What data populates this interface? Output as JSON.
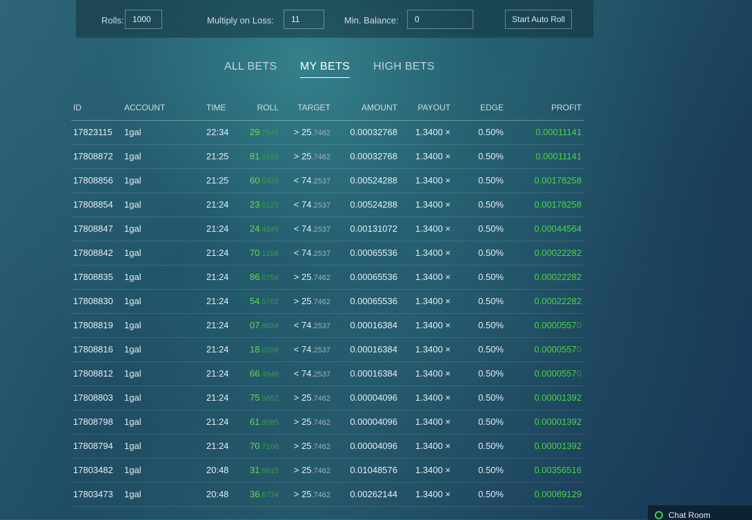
{
  "autoroll": {
    "rolls_label": "Rolls:",
    "rolls_value": "1000",
    "multiply_label": "Multiply on Loss:",
    "multiply_value": "11",
    "min_balance_label": "Min. Balance:",
    "min_balance_value": "0",
    "start_button": "Start Auto Roll"
  },
  "tabs": [
    {
      "label": "ALL BETS",
      "active": false
    },
    {
      "label": "MY BETS",
      "active": true
    },
    {
      "label": "HIGH BETS",
      "active": false
    }
  ],
  "table": {
    "headers": [
      "ID",
      "ACCOUNT",
      "TIME",
      "ROLL",
      "TARGET",
      "AMOUNT",
      "PAYOUT",
      "EDGE",
      "PROFIT"
    ],
    "rows": [
      {
        "id": "17823115",
        "account": "1gal",
        "time": "22:34",
        "roll_int": "29",
        "roll_frac": ".7545",
        "target_op": "> 25",
        "target_frac": ".7462",
        "amount": "0.00032768",
        "payout": "1.3400 ×",
        "edge": "0.50%",
        "profit": "0.00011141",
        "profit_tail": ""
      },
      {
        "id": "17808872",
        "account": "1gal",
        "time": "21:25",
        "roll_int": "81",
        "roll_frac": ".0193",
        "target_op": "> 25",
        "target_frac": ".7462",
        "amount": "0.00032768",
        "payout": "1.3400 ×",
        "edge": "0.50%",
        "profit": "0.00011141",
        "profit_tail": ""
      },
      {
        "id": "17808856",
        "account": "1gal",
        "time": "21:25",
        "roll_int": "60",
        "roll_frac": ".5434",
        "target_op": "< 74",
        "target_frac": ".2537",
        "amount": "0.00524288",
        "payout": "1.3400 ×",
        "edge": "0.50%",
        "profit": "0.00178258",
        "profit_tail": ""
      },
      {
        "id": "17808854",
        "account": "1gal",
        "time": "21:24",
        "roll_int": "23",
        "roll_frac": ".0123",
        "target_op": "< 74",
        "target_frac": ".2537",
        "amount": "0.00524288",
        "payout": "1.3400 ×",
        "edge": "0.50%",
        "profit": "0.00178258",
        "profit_tail": ""
      },
      {
        "id": "17808847",
        "account": "1gal",
        "time": "21:24",
        "roll_int": "24",
        "roll_frac": ".4849",
        "target_op": "< 74",
        "target_frac": ".2537",
        "amount": "0.00131072",
        "payout": "1.3400 ×",
        "edge": "0.50%",
        "profit": "0.00044564",
        "profit_tail": ""
      },
      {
        "id": "17808842",
        "account": "1gal",
        "time": "21:24",
        "roll_int": "70",
        "roll_frac": ".1298",
        "target_op": "< 74",
        "target_frac": ".2537",
        "amount": "0.00065536",
        "payout": "1.3400 ×",
        "edge": "0.50%",
        "profit": "0.00022282",
        "profit_tail": ""
      },
      {
        "id": "17808835",
        "account": "1gal",
        "time": "21:24",
        "roll_int": "86",
        "roll_frac": ".0754",
        "target_op": "> 25",
        "target_frac": ".7462",
        "amount": "0.00065536",
        "payout": "1.3400 ×",
        "edge": "0.50%",
        "profit": "0.00022282",
        "profit_tail": ""
      },
      {
        "id": "17808830",
        "account": "1gal",
        "time": "21:24",
        "roll_int": "54",
        "roll_frac": ".5702",
        "target_op": "> 25",
        "target_frac": ".7462",
        "amount": "0.00065536",
        "payout": "1.3400 ×",
        "edge": "0.50%",
        "profit": "0.00022282",
        "profit_tail": ""
      },
      {
        "id": "17808819",
        "account": "1gal",
        "time": "21:24",
        "roll_int": "07",
        "roll_frac": ".9934",
        "target_op": "< 74",
        "target_frac": ".2537",
        "amount": "0.00016384",
        "payout": "1.3400 ×",
        "edge": "0.50%",
        "profit": "0.0000557",
        "profit_tail": "0"
      },
      {
        "id": "17808816",
        "account": "1gal",
        "time": "21:24",
        "roll_int": "18",
        "roll_frac": ".0598",
        "target_op": "< 74",
        "target_frac": ".2537",
        "amount": "0.00016384",
        "payout": "1.3400 ×",
        "edge": "0.50%",
        "profit": "0.0000557",
        "profit_tail": "0"
      },
      {
        "id": "17808812",
        "account": "1gal",
        "time": "21:24",
        "roll_int": "66",
        "roll_frac": ".4846",
        "target_op": "< 74",
        "target_frac": ".2537",
        "amount": "0.00016384",
        "payout": "1.3400 ×",
        "edge": "0.50%",
        "profit": "0.0000557",
        "profit_tail": "0"
      },
      {
        "id": "17808803",
        "account": "1gal",
        "time": "21:24",
        "roll_int": "75",
        "roll_frac": ".5652",
        "target_op": "> 25",
        "target_frac": ".7462",
        "amount": "0.00004096",
        "payout": "1.3400 ×",
        "edge": "0.50%",
        "profit": "0.00001392",
        "profit_tail": ""
      },
      {
        "id": "17808798",
        "account": "1gal",
        "time": "21:24",
        "roll_int": "61",
        "roll_frac": ".9385",
        "target_op": "> 25",
        "target_frac": ".7462",
        "amount": "0.00004096",
        "payout": "1.3400 ×",
        "edge": "0.50%",
        "profit": "0.00001392",
        "profit_tail": ""
      },
      {
        "id": "17808794",
        "account": "1gal",
        "time": "21:24",
        "roll_int": "70",
        "roll_frac": ".7106",
        "target_op": "> 25",
        "target_frac": ".7462",
        "amount": "0.00004096",
        "payout": "1.3400 ×",
        "edge": "0.50%",
        "profit": "0.00001392",
        "profit_tail": ""
      },
      {
        "id": "17803482",
        "account": "1gal",
        "time": "20:48",
        "roll_int": "31",
        "roll_frac": ".9615",
        "target_op": "> 25",
        "target_frac": ".7462",
        "amount": "0.01048576",
        "payout": "1.3400 ×",
        "edge": "0.50%",
        "profit": "0.00356516",
        "profit_tail": ""
      },
      {
        "id": "17803473",
        "account": "1gal",
        "time": "20:48",
        "roll_int": "36",
        "roll_frac": ".6734",
        "target_op": "> 25",
        "target_frac": ".7462",
        "amount": "0.00262144",
        "payout": "1.3400 ×",
        "edge": "0.50%",
        "profit": "0.00089129",
        "profit_tail": ""
      }
    ]
  },
  "chat": {
    "label": "Chat Room",
    "status_color": "#3fd24a"
  },
  "colors": {
    "win_green": "#4bd443",
    "background": "#1f4d63"
  }
}
